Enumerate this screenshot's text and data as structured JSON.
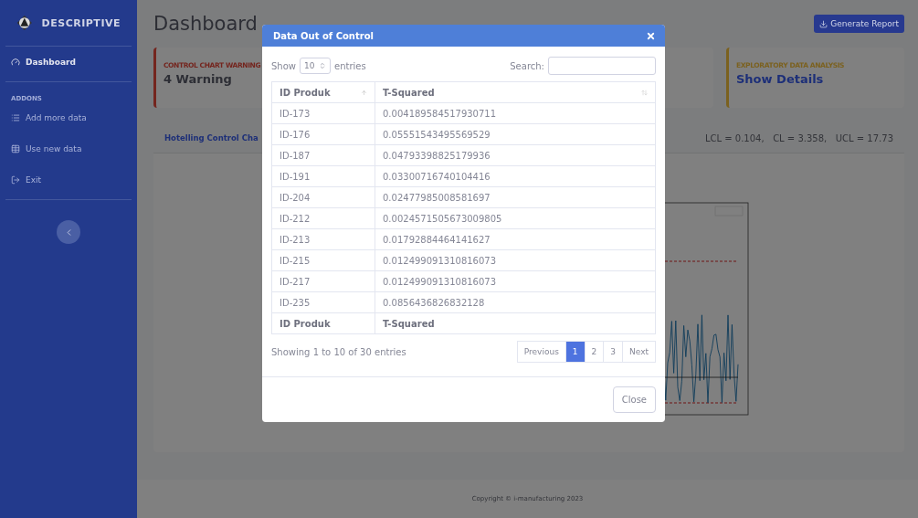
{
  "sidebar": {
    "brand": "DESCRIPTIVE",
    "sections": [
      {
        "items": [
          {
            "label": "Dashboard",
            "kind": "dashboard",
            "selected": true
          }
        ]
      },
      {
        "heading": "ADDONS",
        "items": [
          {
            "label": "Add more data",
            "kind": "list",
            "selected": false
          },
          {
            "label": "Use new data",
            "kind": "table",
            "selected": false
          },
          {
            "label": "Exit",
            "kind": "exit",
            "selected": false
          }
        ]
      }
    ]
  },
  "header": {
    "title": "Dashboard",
    "report_button": "Generate Report"
  },
  "stat_cards": [
    {
      "label": "CONTROL CHART WARNING",
      "value": "4 Warning",
      "color": "#74251e"
    },
    {
      "label": "EXPLORATORY DATA ANALYSIS",
      "value": "Show Details",
      "color": "#7b611f"
    }
  ],
  "chart_card": {
    "title": "Hotelling Control Cha",
    "limits": "LCL = 0.104,   CL = 3.358,   UCL = 17.73"
  },
  "footer": "Copyright © i-manufacturing 2023",
  "modal": {
    "title": "Data Out of Control",
    "length": {
      "before": "Show",
      "value": "10",
      "after": "entries"
    },
    "search_label": "Search:",
    "columns": [
      "ID Produk",
      "T-Squared"
    ],
    "rows": [
      [
        "ID-173",
        "0.004189584517930711"
      ],
      [
        "ID-176",
        "0.05551543495569529"
      ],
      [
        "ID-187",
        "0.04793398825179936"
      ],
      [
        "ID-191",
        "0.03300716740104416"
      ],
      [
        "ID-204",
        "0.02477985008581697"
      ],
      [
        "ID-212",
        "0.0024571505673009805"
      ],
      [
        "ID-213",
        "0.01792884464141627"
      ],
      [
        "ID-215",
        "0.012499091310816073"
      ],
      [
        "ID-217",
        "0.012499091310816073"
      ],
      [
        "ID-235",
        "0.0856436826832128"
      ]
    ],
    "footer_columns": [
      "ID Produk",
      "T-Squared"
    ],
    "info": "Showing 1 to 10 of 30 entries",
    "pages": [
      {
        "label": "Previous",
        "selected": false
      },
      {
        "label": "1",
        "selected": true
      },
      {
        "label": "2",
        "selected": false
      },
      {
        "label": "3",
        "selected": false
      },
      {
        "label": "Next",
        "selected": false
      }
    ],
    "close_button": "Close"
  }
}
